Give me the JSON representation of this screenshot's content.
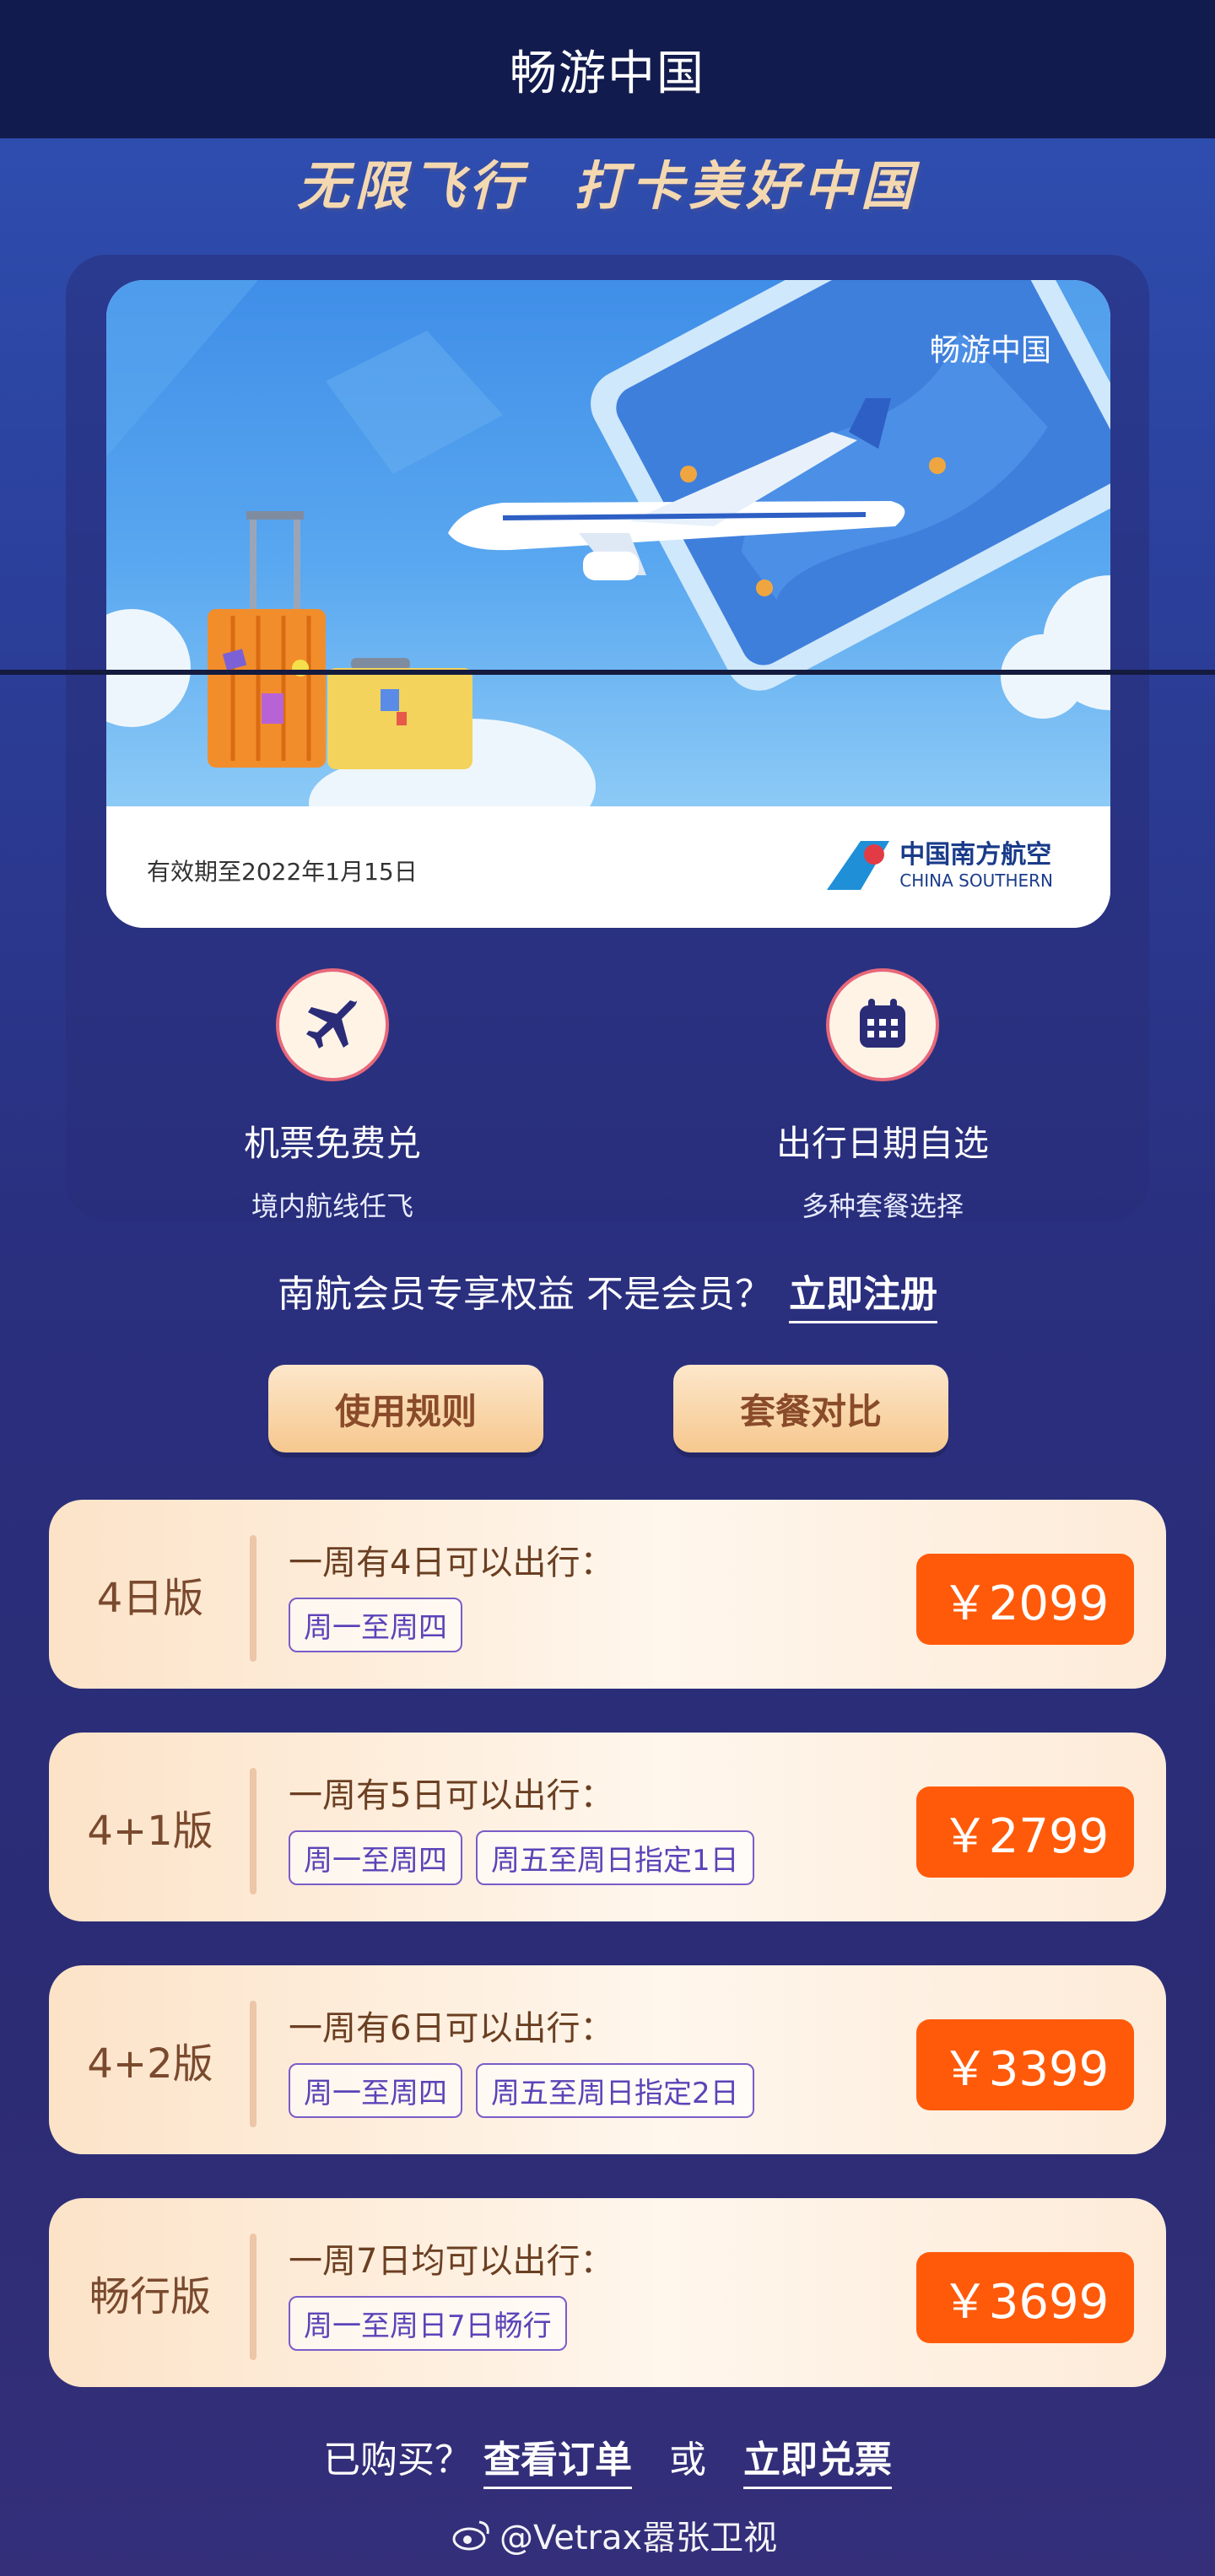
{
  "header": {
    "title": "畅游中国"
  },
  "slogan": {
    "part1": "无限飞行",
    "part2": "打卡美好中国"
  },
  "card": {
    "name": "畅游中国",
    "validity": "有效期至2022年1月15日",
    "airline_cn": "中国南方航空",
    "airline_en": "CHINA SOUTHERN"
  },
  "features": [
    {
      "icon": "airplane-icon",
      "title": "机票免费兑",
      "subtitle": "境内航线任飞"
    },
    {
      "icon": "calendar-icon",
      "title": "出行日期自选",
      "subtitle": "多种套餐选择"
    }
  ],
  "member": {
    "text": "南航会员专享权益 不是会员？",
    "link": "立即注册"
  },
  "buttons": {
    "rules": "使用规则",
    "compare": "套餐对比"
  },
  "plans": [
    {
      "name": "4日版",
      "desc": "一周有4日可以出行：",
      "tags": [
        "周一至周四"
      ],
      "price": "￥2099"
    },
    {
      "name": "4+1版",
      "desc": "一周有5日可以出行：",
      "tags": [
        "周一至周四",
        "周五至周日指定1日"
      ],
      "price": "￥2799"
    },
    {
      "name": "4+2版",
      "desc": "一周有6日可以出行：",
      "tags": [
        "周一至周四",
        "周五至周日指定2日"
      ],
      "price": "￥3399"
    },
    {
      "name": "畅行版",
      "desc": "一周7日均可以出行：",
      "tags": [
        "周一至周日7日畅行"
      ],
      "price": "￥3699"
    }
  ],
  "footer": {
    "purchased": "已购买？",
    "orders": "查看订单",
    "or": "或",
    "redeem": "立即兑票"
  },
  "watermark": {
    "text": "@Vetrax嚣张卫视"
  },
  "colors": {
    "topbar": "#121b4d",
    "price": "#ff5a0a",
    "accent": "#f6c88e"
  }
}
